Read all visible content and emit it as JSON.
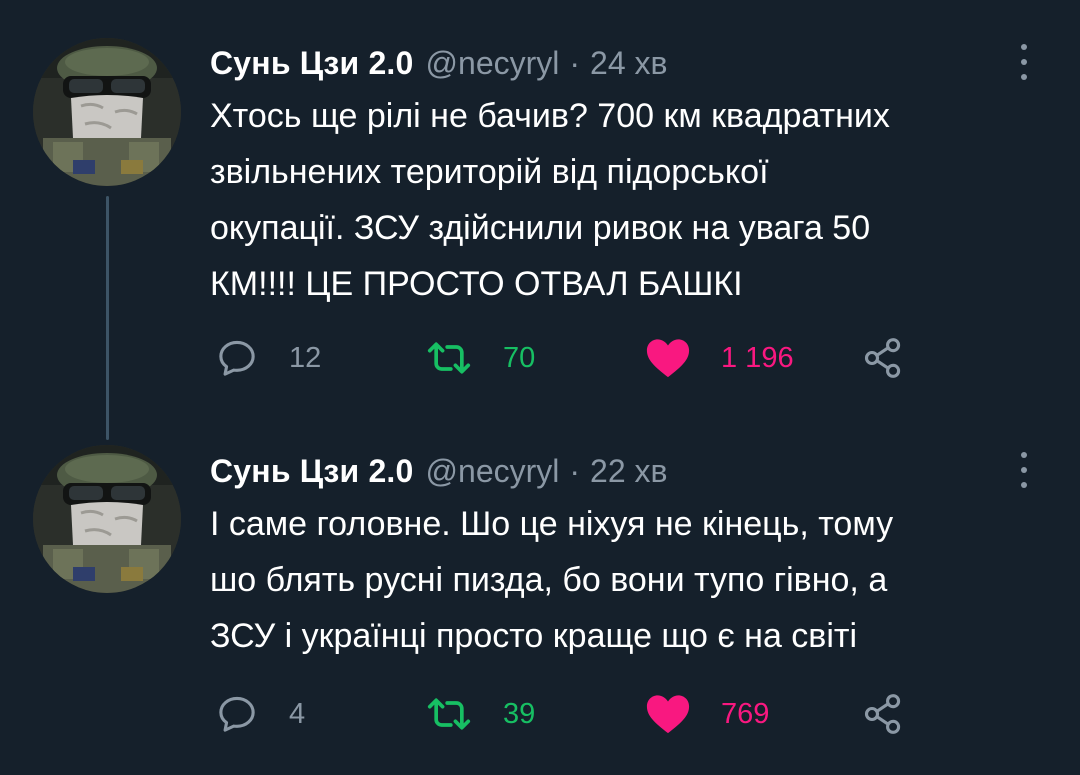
{
  "tweets": [
    {
      "author_name": "Сунь Цзи 2.0",
      "handle": "@necyryl",
      "separator": "·",
      "time": "24 хв",
      "text": "Хтось ще рілі не бачив? 700 км квадратних\nзвільнених територій від підорської\nокупації. ЗСУ здійснили ривок на увага 50\nКМ!!!!  ЦЕ ПРОСТО ОТВАЛ БАШКІ",
      "replies": "12",
      "retweets": "70",
      "likes": "1 196",
      "liked": true,
      "retweeted": true
    },
    {
      "author_name": "Сунь Цзи 2.0",
      "handle": "@necyryl",
      "separator": "·",
      "time": "22 хв",
      "text": "І саме головне. Шо це ніхуя не кінець, тому\nшо блять русні пизда, бо вони тупо гівно, а\nЗСУ і українці просто краще що є на світі",
      "replies": "4",
      "retweets": "39",
      "likes": "769",
      "liked": true,
      "retweeted": true
    }
  ],
  "icons": {
    "reply": "speech-bubble-icon",
    "retweet": "retweet-arrows-icon",
    "like": "heart-icon",
    "share": "share-nodes-icon",
    "more": "vertical-ellipsis-icon"
  },
  "colors": {
    "background": "#15202b",
    "text": "#ffffff",
    "secondary": "#8b98a5",
    "retweet_active": "#17bf63",
    "like_active": "#f91880",
    "thread_line": "#3d5466"
  }
}
